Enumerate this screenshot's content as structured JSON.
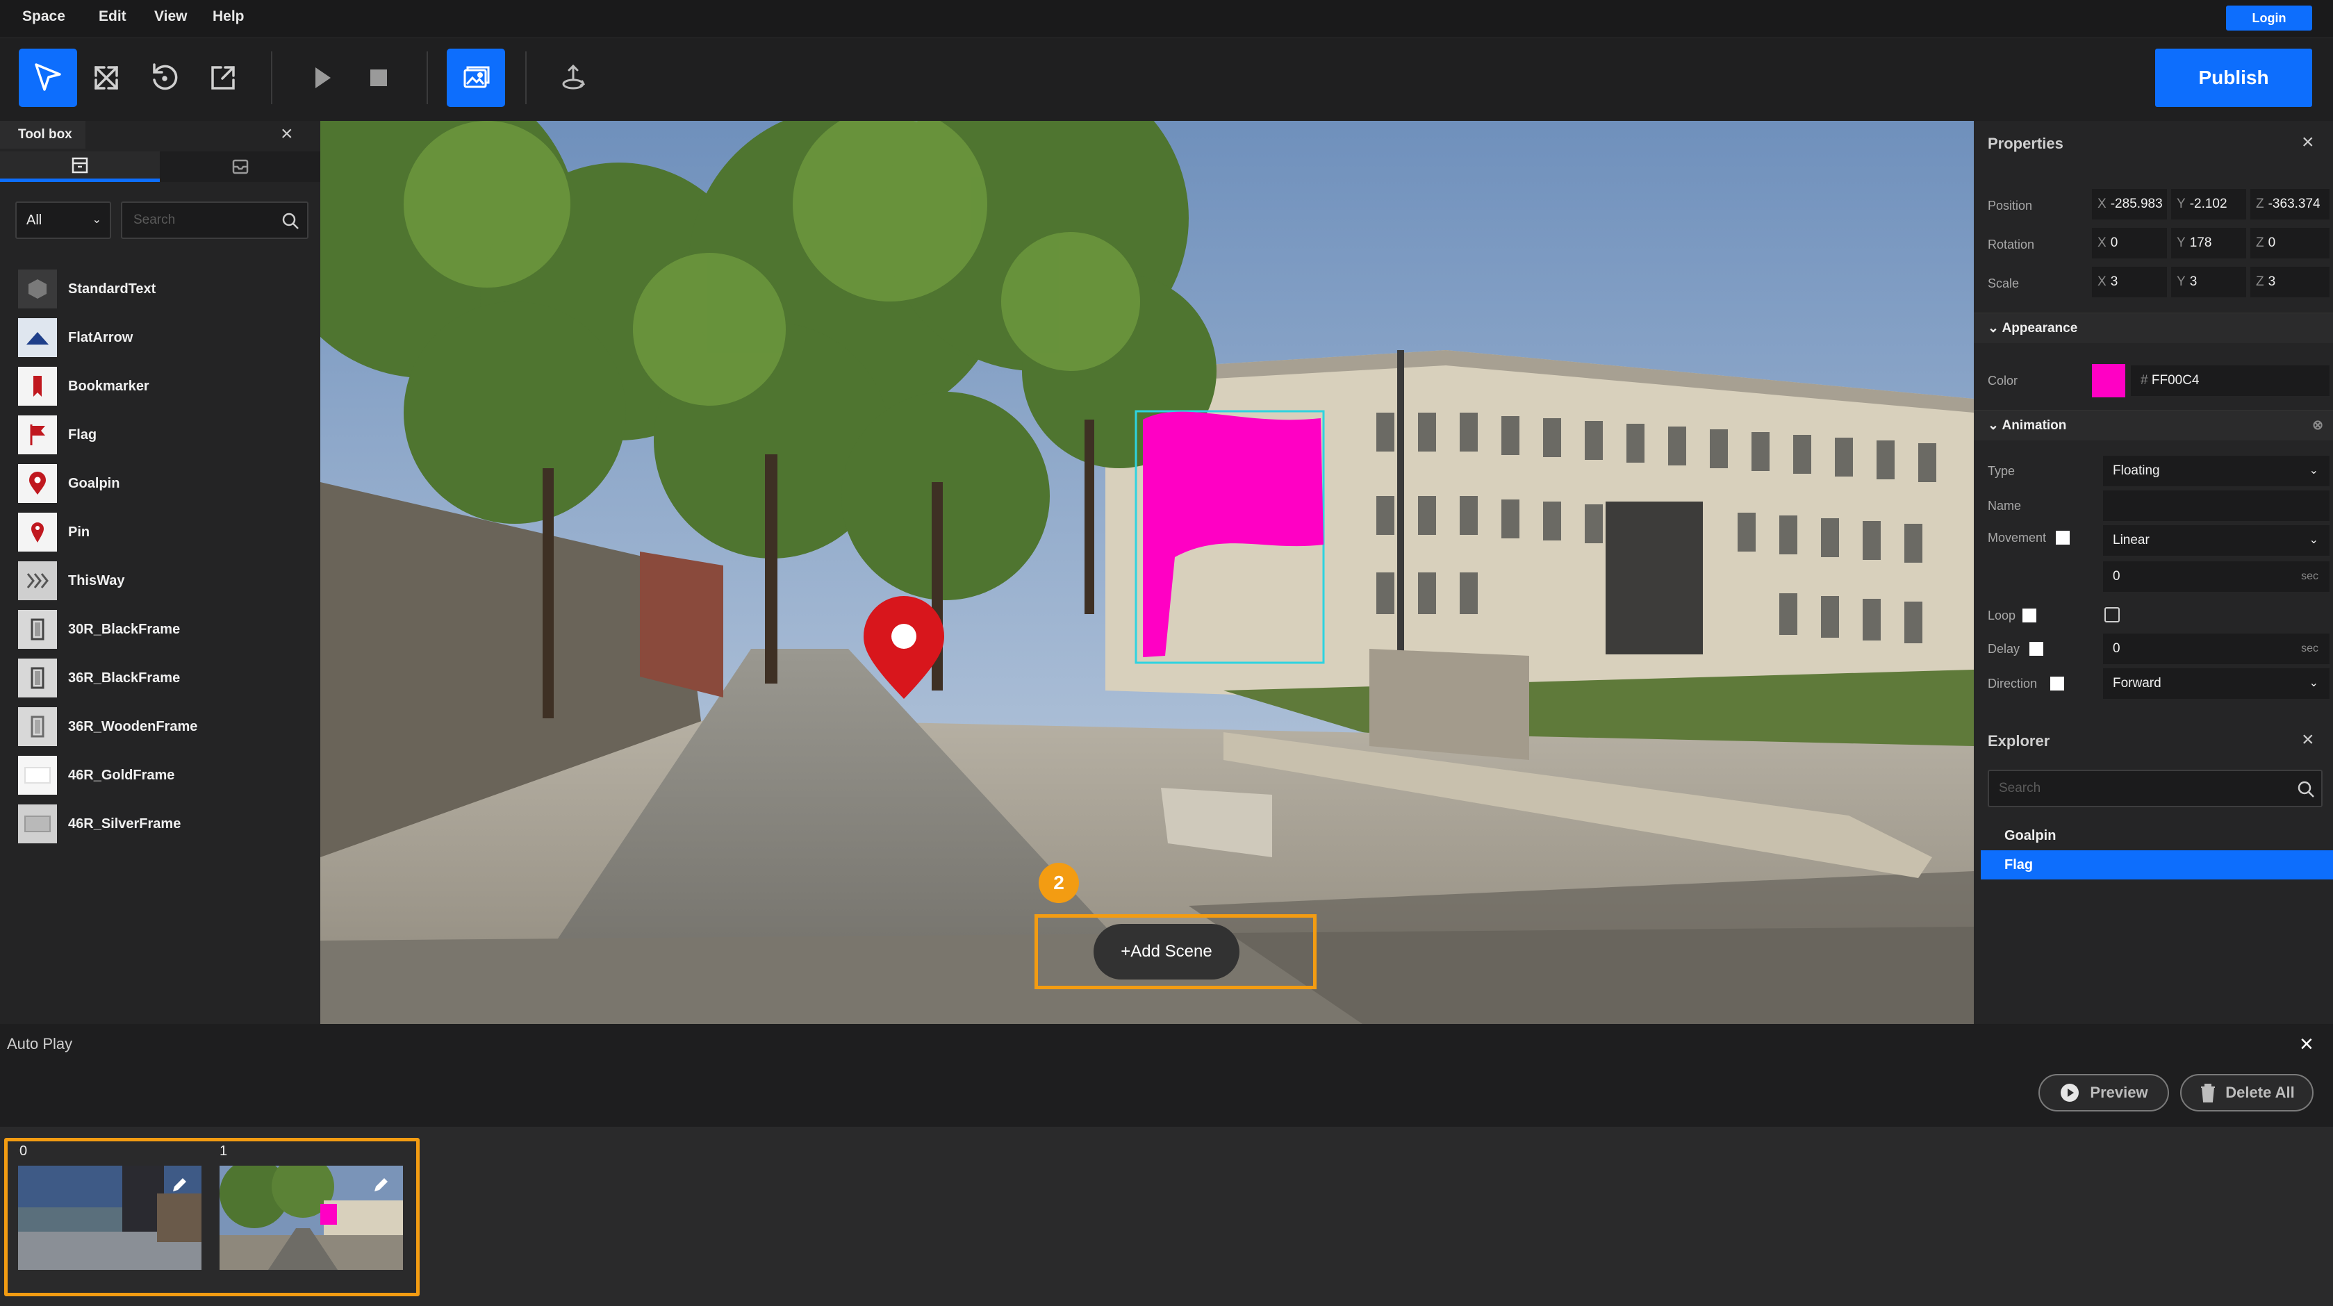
{
  "menu": {
    "items": [
      "Space",
      "Edit",
      "View",
      "Help"
    ],
    "login_label": "Login"
  },
  "toolbar": {
    "tools": [
      "select-tool",
      "transform-tool",
      "rotate-tool",
      "scale-tool",
      "play-button",
      "stop-button",
      "scene-image-tool",
      "camera-tool"
    ],
    "publish_label": "Publish"
  },
  "toolbox": {
    "title": "Tool box",
    "filter_value": "All",
    "search_placeholder": "Search",
    "items": [
      {
        "label": "StandardText",
        "icon": "cube-icon"
      },
      {
        "label": "FlatArrow",
        "icon": "arrow-icon"
      },
      {
        "label": "Bookmarker",
        "icon": "bookmark-icon"
      },
      {
        "label": "Flag",
        "icon": "flag-icon"
      },
      {
        "label": "Goalpin",
        "icon": "goalpin-icon"
      },
      {
        "label": "Pin",
        "icon": "pin-icon"
      },
      {
        "label": "ThisWay",
        "icon": "thisway-icon"
      },
      {
        "label": "30R_BlackFrame",
        "icon": "frame-icon"
      },
      {
        "label": "36R_BlackFrame",
        "icon": "frame-icon"
      },
      {
        "label": "36R_WoodenFrame",
        "icon": "frame-icon"
      },
      {
        "label": "46R_GoldFrame",
        "icon": "frame-icon"
      },
      {
        "label": "46R_SilverFrame",
        "icon": "frame-icon"
      }
    ]
  },
  "viewport": {
    "step_badge": "2",
    "add_scene_label": "+Add Scene",
    "accent": "#f39c12",
    "flag_color": "#FF00C4"
  },
  "properties": {
    "title": "Properties",
    "position": {
      "label": "Position",
      "x": "-285.983",
      "y": "-2.102",
      "z": "-363.374"
    },
    "rotation": {
      "label": "Rotation",
      "x": "0",
      "y": "178",
      "z": "0"
    },
    "scale": {
      "label": "Scale",
      "x": "3",
      "y": "3",
      "z": "3"
    },
    "appearance": {
      "title": "Appearance",
      "color_label": "Color",
      "color_hex": "FF00C4",
      "color_prefix": "#"
    },
    "animation": {
      "title": "Animation",
      "type_label": "Type",
      "type_value": "Floating",
      "name_label": "Name",
      "name_value": "",
      "movement_label": "Movement",
      "movement_value": "Linear",
      "duration_value": "0",
      "duration_unit": "sec",
      "loop_label": "Loop",
      "delay_label": "Delay",
      "delay_value": "0",
      "delay_unit": "sec",
      "direction_label": "Direction",
      "direction_value": "Forward"
    }
  },
  "explorer": {
    "title": "Explorer",
    "search_placeholder": "Search",
    "items": [
      {
        "label": "Goalpin",
        "selected": false
      },
      {
        "label": "Flag",
        "selected": true
      }
    ]
  },
  "autoplay": {
    "label": "Auto Play",
    "preview_label": "Preview",
    "delete_all_label": "Delete All"
  },
  "scenes": [
    {
      "index": "0"
    },
    {
      "index": "1"
    }
  ],
  "colors": {
    "primary": "#0d6efd",
    "highlight": "#f39c12"
  }
}
